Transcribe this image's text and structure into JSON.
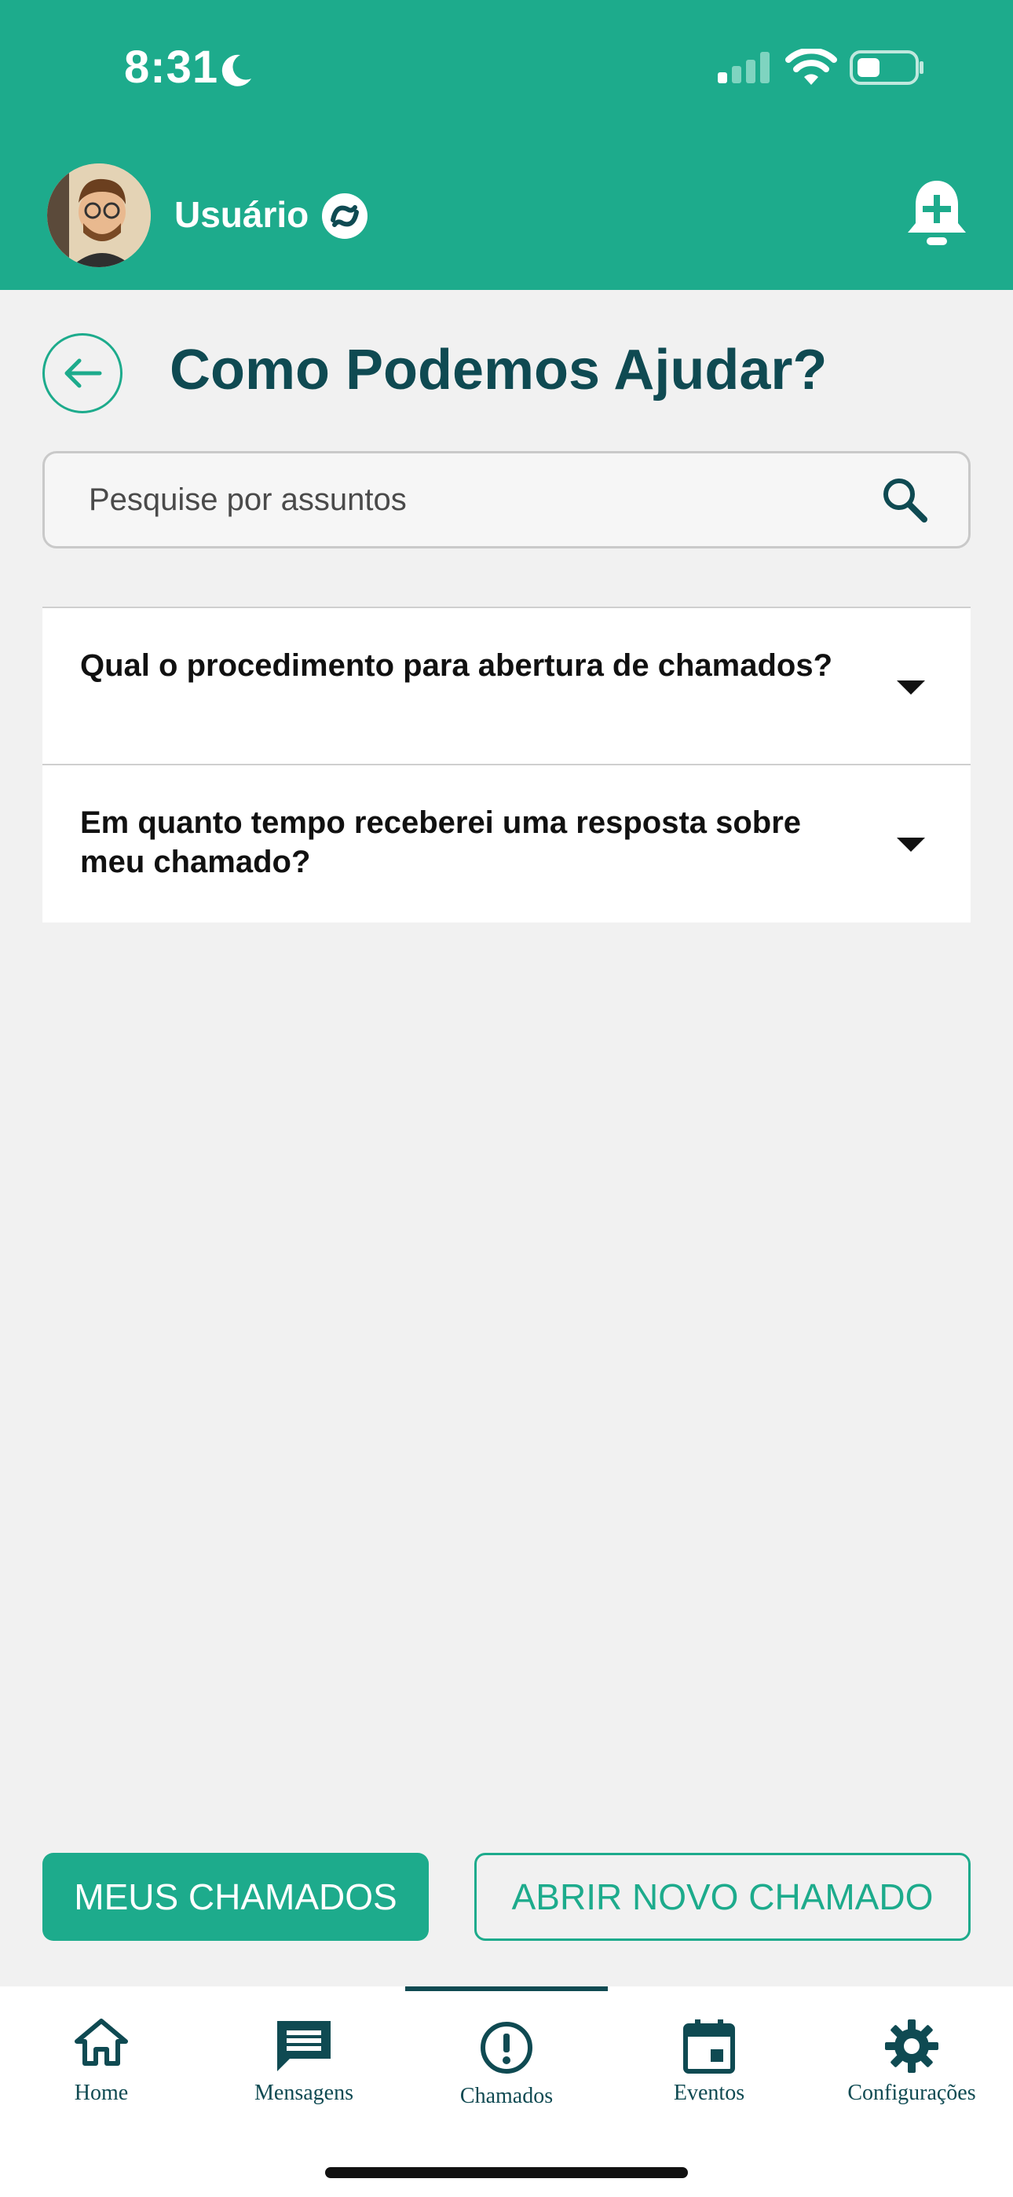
{
  "status_bar": {
    "time": "8:31"
  },
  "header": {
    "user_name": "Usuário"
  },
  "page": {
    "title": "Como Podemos Ajudar?"
  },
  "search": {
    "placeholder": "Pesquise por assuntos"
  },
  "faq": [
    {
      "question": "Qual o procedimento para abertura de chamados?"
    },
    {
      "question": "Em quanto tempo receberei uma resposta sobre meu chamado?"
    }
  ],
  "actions": {
    "my_tickets": "MEUS CHAMADOS",
    "new_ticket": "ABRIR NOVO CHAMADO"
  },
  "tabs": [
    {
      "label": "Home",
      "icon": "home-icon"
    },
    {
      "label": "Mensagens",
      "icon": "message-icon"
    },
    {
      "label": "Chamados",
      "icon": "alert-icon",
      "active": true
    },
    {
      "label": "Eventos",
      "icon": "calendar-icon"
    },
    {
      "label": "Configurações",
      "icon": "gear-icon"
    }
  ],
  "colors": {
    "primary": "#1dab8c",
    "dark": "#0f4a52",
    "background": "#f1f1f1"
  }
}
